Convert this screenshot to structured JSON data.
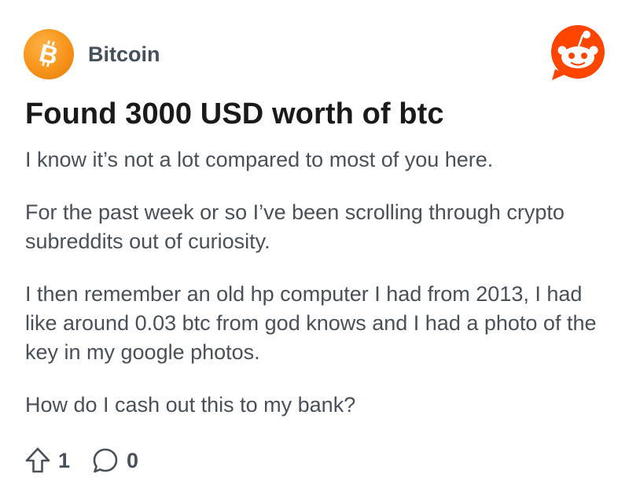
{
  "subreddit": {
    "name": "Bitcoin",
    "avatar_icon": "bitcoin-logo-icon",
    "avatar_color": "#f7931a"
  },
  "app": {
    "logo_icon": "reddit-logo-icon",
    "brand_color": "#ff4500"
  },
  "post": {
    "title": "Found 3000 USD worth of btc",
    "paragraphs": [
      "I know it’s not a lot compared to most of you here.",
      "For the past week or so I’ve been scrolling through crypto subreddits out of curiosity.",
      "I then remember an old hp computer I had from 2013, I had like around 0.03 btc from god knows and I had a photo of the key in my google photos.",
      "How do I cash out this to my bank?"
    ]
  },
  "actions": {
    "upvote_icon": "upvote-arrow-icon",
    "upvote_count": "1",
    "comment_icon": "comment-bubble-icon",
    "comment_count": "0"
  }
}
